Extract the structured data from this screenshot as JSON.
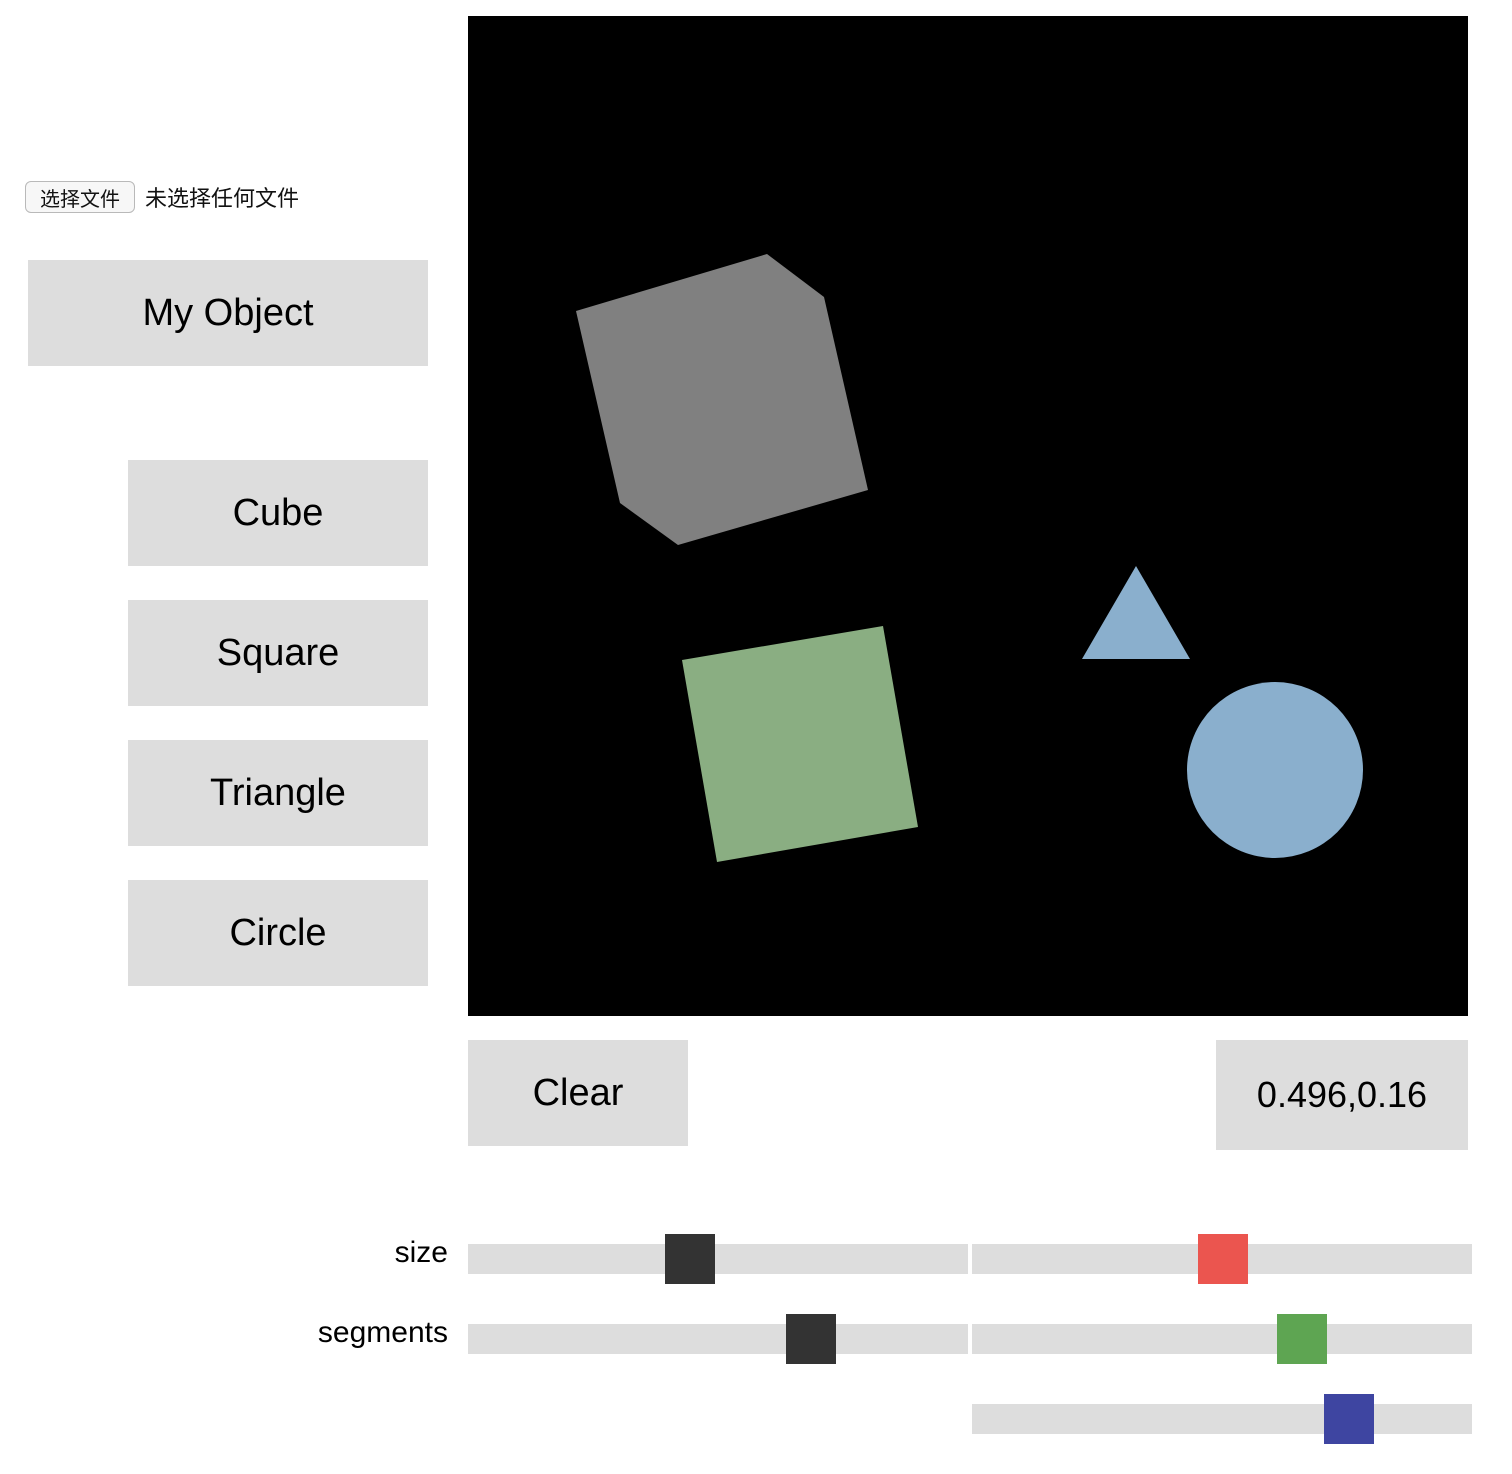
{
  "file_input": {
    "button_label": "选择文件",
    "status": "未选择任何文件"
  },
  "buttons": {
    "my_object": "My Object",
    "cube": "Cube",
    "square": "Square",
    "triangle": "Triangle",
    "circle": "Circle",
    "clear": "Clear"
  },
  "coordinate_readout": "0.496,0.16",
  "canvas": {
    "background": "#000000",
    "shapes": [
      {
        "name": "cube",
        "color": "#808080"
      },
      {
        "name": "square",
        "color": "#8aae82"
      },
      {
        "name": "triangle",
        "color": "#8aafcd"
      },
      {
        "name": "circle",
        "color": "#8aafcd"
      }
    ]
  },
  "sliders": {
    "size_label": "size",
    "segments_label": "segments",
    "size": {
      "value": 0.438
    },
    "segments": {
      "value": 0.706
    },
    "red": {
      "value": 0.502,
      "color": "#eb554f"
    },
    "green": {
      "value": 0.678,
      "color": "#5ea552"
    },
    "blue": {
      "value": 0.782,
      "color": "#3e45a1"
    },
    "thumb_dark_color": "#333333"
  }
}
